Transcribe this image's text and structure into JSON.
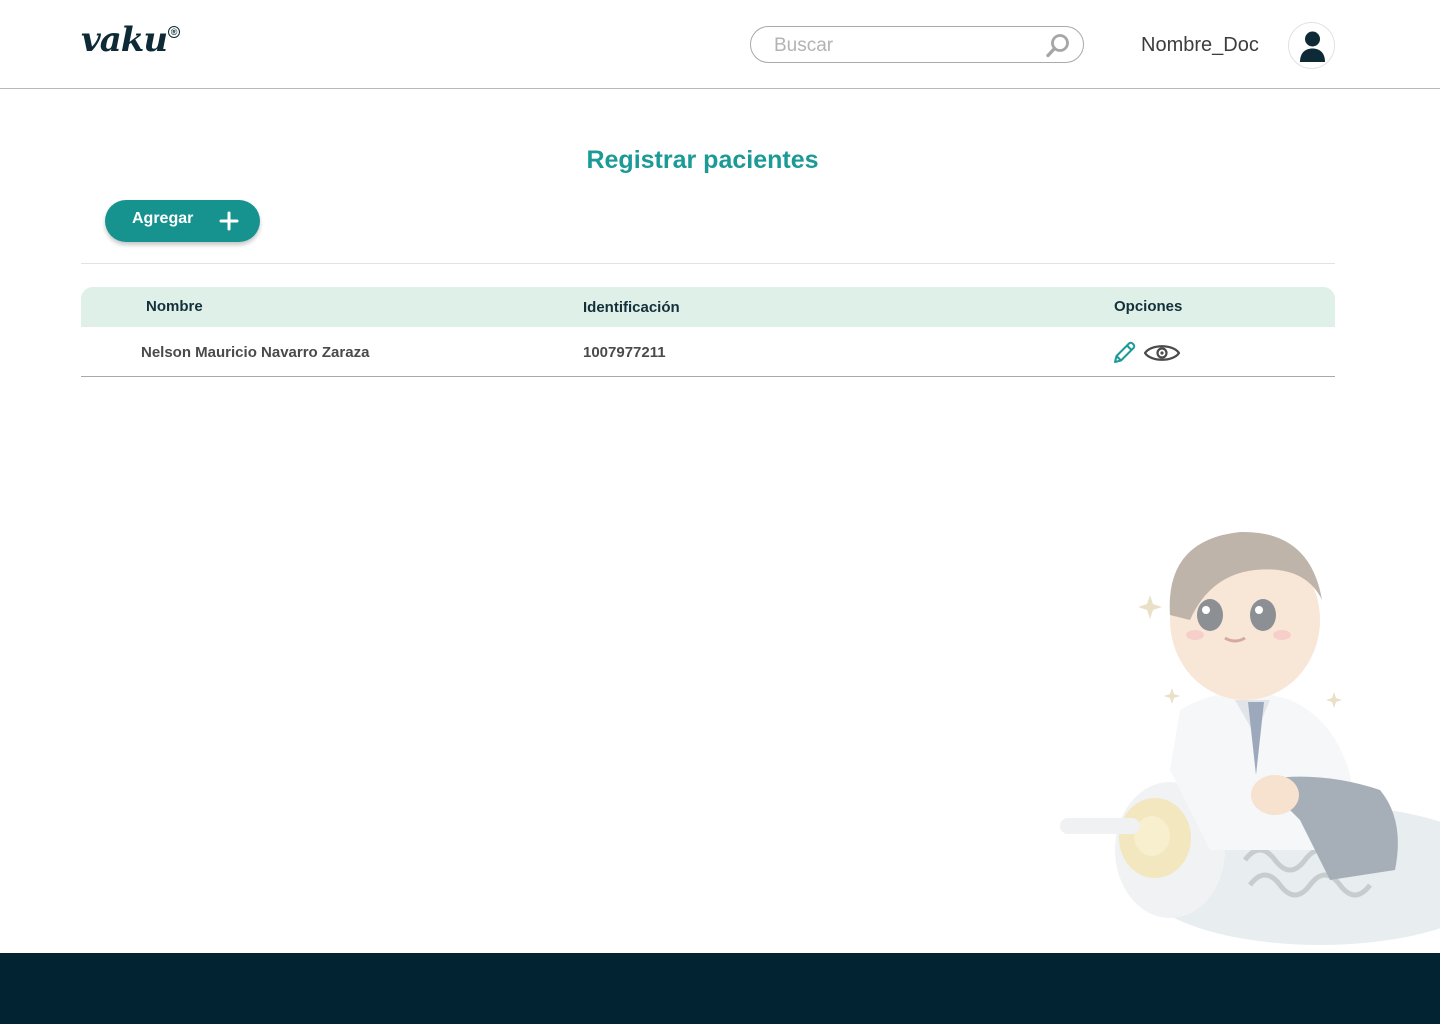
{
  "header": {
    "logo_text": "vaku",
    "logo_mark": "®",
    "search_placeholder": "Buscar",
    "search_icon": "search-icon",
    "user_name": "Nombre_Doc",
    "avatar_icon": "user-icon"
  },
  "main": {
    "title": "Registrar pacientes",
    "add_button_label": "Agregar",
    "add_button_icon": "plus-icon"
  },
  "table": {
    "columns": [
      "Nombre",
      "Identificación",
      "Opciones"
    ],
    "rows": [
      {
        "name": "Nelson Mauricio Navarro Zaraza",
        "identification": "1007977211",
        "actions": [
          "edit-icon",
          "view-icon"
        ]
      }
    ]
  },
  "colors": {
    "accent": "#16938f",
    "title": "#1b9a97",
    "table_header_bg": "#dff0e8",
    "footer_bg": "#012332",
    "dark_text": "#0d2a36"
  },
  "illustration": {
    "icon": "doctor-illustration"
  }
}
